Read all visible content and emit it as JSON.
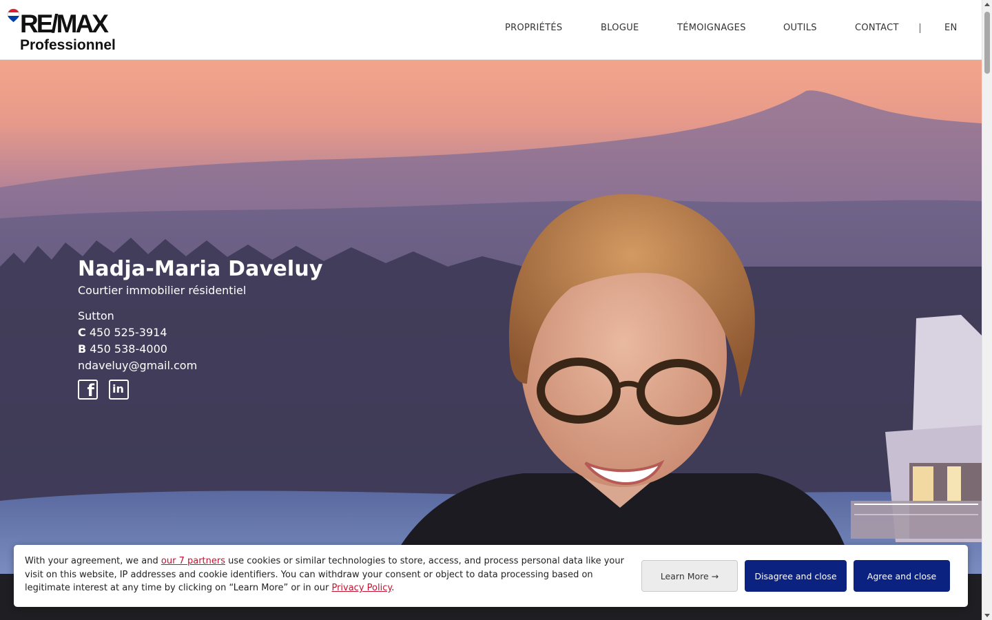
{
  "brand": {
    "logo_text": "RE/MAX",
    "logo_subtitle": "Professionnel",
    "colors": {
      "red": "#dc1c2e",
      "blue": "#003da5",
      "navy_button": "#0c2280"
    }
  },
  "nav": {
    "items": [
      {
        "label": "PROPRIÉTÉS"
      },
      {
        "label": "BLOGUE"
      },
      {
        "label": "TÉMOIGNAGES"
      },
      {
        "label": "OUTILS"
      },
      {
        "label": "CONTACT"
      }
    ],
    "language": "EN"
  },
  "agent": {
    "name": "Nadja-Maria Daveluy",
    "title": "Courtier immobilier résidentiel",
    "city": "Sutton",
    "cell_prefix": "C",
    "cell": "450 525-3914",
    "office_prefix": "B",
    "office": "450 538-4000",
    "email": "ndaveluy@gmail.com",
    "social": [
      {
        "icon": "facebook-icon"
      },
      {
        "icon": "linkedin-icon"
      }
    ]
  },
  "cookie_banner": {
    "text_before_link": "With your agreement, we and ",
    "partners_link": "our 7 partners",
    "text_middle": " use cookies or similar technologies to store, access, and process personal data like your visit on this website, IP addresses and cookie identifiers. You can withdraw your consent or object to data processing based on legitimate interest at any time by clicking on “Learn More” or in our ",
    "privacy_link": "Privacy Policy",
    "text_end": ".",
    "learn_more": "Learn More →",
    "disagree": "Disagree and close",
    "agree": "Agree and close"
  }
}
